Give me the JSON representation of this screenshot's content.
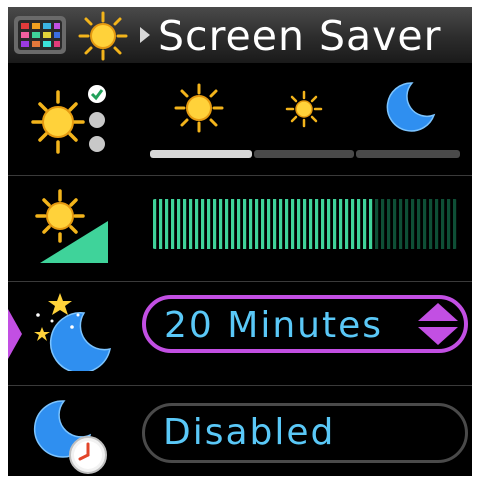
{
  "header": {
    "title": "Screen Saver",
    "icons": [
      "apps-icon",
      "sun-icon",
      "chevron-right-icon"
    ]
  },
  "rows": {
    "brightness_mode": {
      "icon": "sun-with-options-icon",
      "options": [
        "bright-sun-icon",
        "small-sun-icon",
        "moon-icon"
      ],
      "selected_index": 0
    },
    "brightness_level": {
      "icon": "sun-level-icon",
      "level_fraction": 0.72
    },
    "timeout": {
      "icon": "moon-stars-icon",
      "value": "20 Minutes"
    },
    "schedule": {
      "icon": "moon-clock-icon",
      "value": "Disabled"
    }
  },
  "colors": {
    "accent": "#c24fe3",
    "value_text": "#5ac8f7",
    "level_fill": "#3fd39a",
    "level_empty": "#0e4f36"
  }
}
